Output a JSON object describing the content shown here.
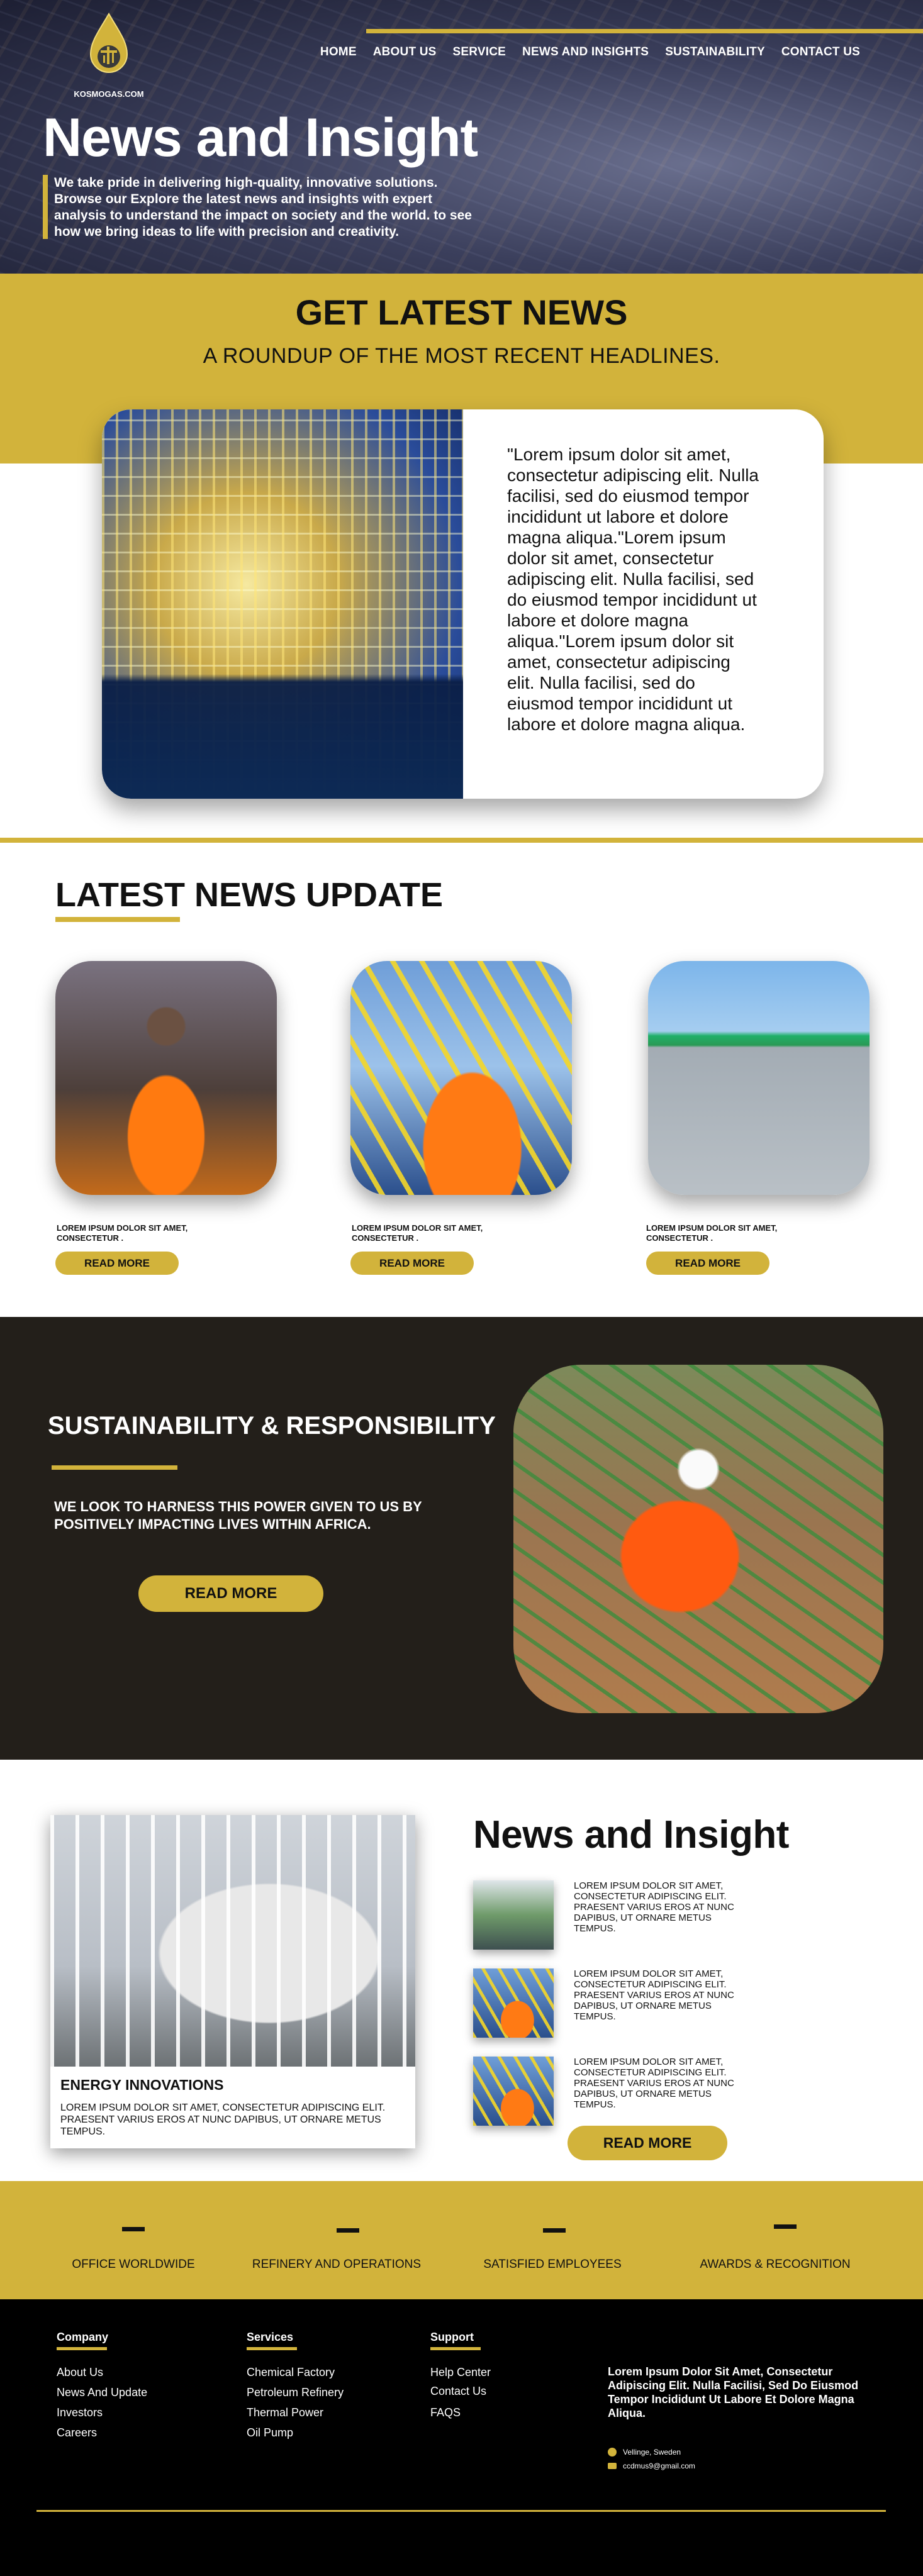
{
  "brand": {
    "logo_text": "KOSMOGAS.COM",
    "accent_color": "#d2b33b",
    "dark_color": "#231f1a"
  },
  "nav": {
    "items": [
      "HOME",
      "ABOUT US",
      "SERVICE",
      "NEWS AND INSIGHTS",
      "SUSTAINABILITY",
      "CONTACT US"
    ]
  },
  "hero": {
    "title": "News and Insight",
    "text": "We take pride in delivering high-quality, innovative solutions. Browse our Explore the latest news and insights with expert analysis to understand the impact on society and the world. to see how we bring ideas to life with precision and creativity."
  },
  "latest": {
    "title": "GET LATEST NEWS",
    "subtitle": "A ROUNDUP OF THE MOST RECENT HEADLINES.",
    "feature_text": "\"Lorem ipsum dolor sit amet, consectetur adipiscing elit. Nulla facilisi, sed do eiusmod tempor incididunt ut labore et dolore magna aliqua.\"Lorem ipsum dolor sit amet, consectetur adipiscing elit. Nulla facilisi, sed do eiusmod tempor incididunt ut labore et dolore magna aliqua.\"Lorem ipsum dolor sit amet, consectetur adipiscing elit. Nulla facilisi, sed do eiusmod tempor incididunt ut labore et dolore magna aliqua."
  },
  "updates": {
    "title": "LATEST NEWS UPDATE",
    "cards": [
      {
        "caption": "LOREM IPSUM DOLOR SIT AMET, CONSECTETUR .",
        "button": "READ MORE"
      },
      {
        "caption": "LOREM IPSUM DOLOR SIT AMET, CONSECTETUR .",
        "button": "READ MORE"
      },
      {
        "caption": "LOREM IPSUM DOLOR SIT AMET, CONSECTETUR .",
        "button": "READ MORE"
      }
    ]
  },
  "sustainability": {
    "title": "SUSTAINABILITY & RESPONSIBILITY",
    "text": "WE LOOK TO HARNESS THIS POWER GIVEN TO US BY POSITIVELY IMPACTING LIVES WITHIN AFRICA.",
    "button": "READ MORE"
  },
  "insight": {
    "title": "News and Insight",
    "card_title": "ENERGY INNOVATIONS",
    "card_text": "LOREM IPSUM DOLOR SIT AMET, CONSECTETUR ADIPISCING ELIT. PRAESENT VARIUS EROS AT NUNC DAPIBUS, UT ORNARE METUS TEMPUS.",
    "items": [
      "LOREM IPSUM DOLOR SIT AMET, CONSECTETUR ADIPISCING ELIT. PRAESENT VARIUS EROS AT NUNC DAPIBUS, UT ORNARE METUS TEMPUS.",
      "LOREM IPSUM DOLOR SIT AMET, CONSECTETUR ADIPISCING ELIT. PRAESENT VARIUS EROS AT NUNC DAPIBUS, UT ORNARE METUS TEMPUS.",
      "LOREM IPSUM DOLOR SIT AMET, CONSECTETUR ADIPISCING ELIT. PRAESENT VARIUS EROS AT NUNC DAPIBUS, UT ORNARE METUS TEMPUS."
    ],
    "button": "READ MORE"
  },
  "stats": {
    "labels": [
      "OFFICE WORLDWIDE",
      "REFINERY AND OPERATIONS",
      "SATISFIED EMPLOYEES",
      "AWARDS & RECOGNITION"
    ]
  },
  "footer": {
    "columns": [
      {
        "heading": "Company",
        "links": [
          "About Us",
          "News And Update",
          "Investors",
          "Careers"
        ]
      },
      {
        "heading": "Services",
        "links": [
          "Chemical Factory",
          "Petroleum Refinery",
          "Thermal Power",
          "Oil Pump"
        ]
      },
      {
        "heading": "Support",
        "links": [
          "Help Center",
          "Contact Us",
          "FAQS"
        ]
      }
    ],
    "about": "Lorem Ipsum Dolor Sit Amet, Consectetur Adipiscing Elit. Nulla Facilisi, Sed Do Eiusmod Tempor Incididunt Ut Labore Et Dolore Magna Aliqua.",
    "location": "Vellinge, Sweden",
    "email": "ccdmus9@gmail.com"
  }
}
